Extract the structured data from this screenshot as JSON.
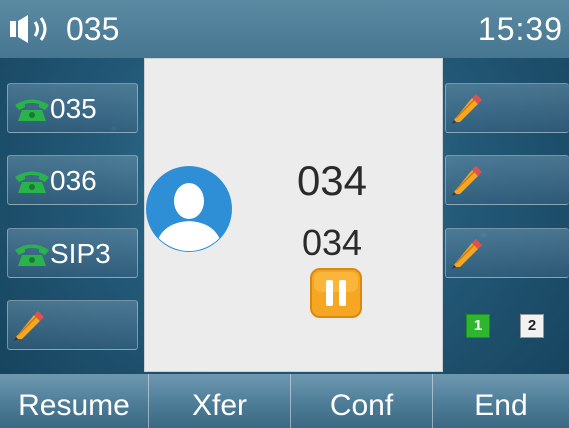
{
  "status_bar": {
    "account": "035",
    "time": "15:39",
    "icon": "speaker-icon"
  },
  "left_keys": [
    {
      "label": "035",
      "icon": "phone-icon"
    },
    {
      "label": "036",
      "icon": "phone-icon"
    },
    {
      "label": "SIP3",
      "icon": "phone-icon"
    },
    {
      "label": "",
      "icon": "pencil-icon"
    }
  ],
  "right_keys": [
    {
      "label": "",
      "icon": "pencil-icon"
    },
    {
      "label": "",
      "icon": "pencil-icon"
    },
    {
      "label": "",
      "icon": "pencil-icon"
    }
  ],
  "call": {
    "name": "034",
    "number": "034",
    "state_icon": "hold-icon",
    "avatar_icon": "contact-avatar-icon"
  },
  "account_badges": [
    "1",
    "2"
  ],
  "softkeys": {
    "resume": "Resume",
    "xfer": "Xfer",
    "conf": "Conf",
    "end": "End"
  },
  "colors": {
    "accent_green": "#2fb62f",
    "hold_orange": "#f5a623",
    "background": "#235a78"
  }
}
